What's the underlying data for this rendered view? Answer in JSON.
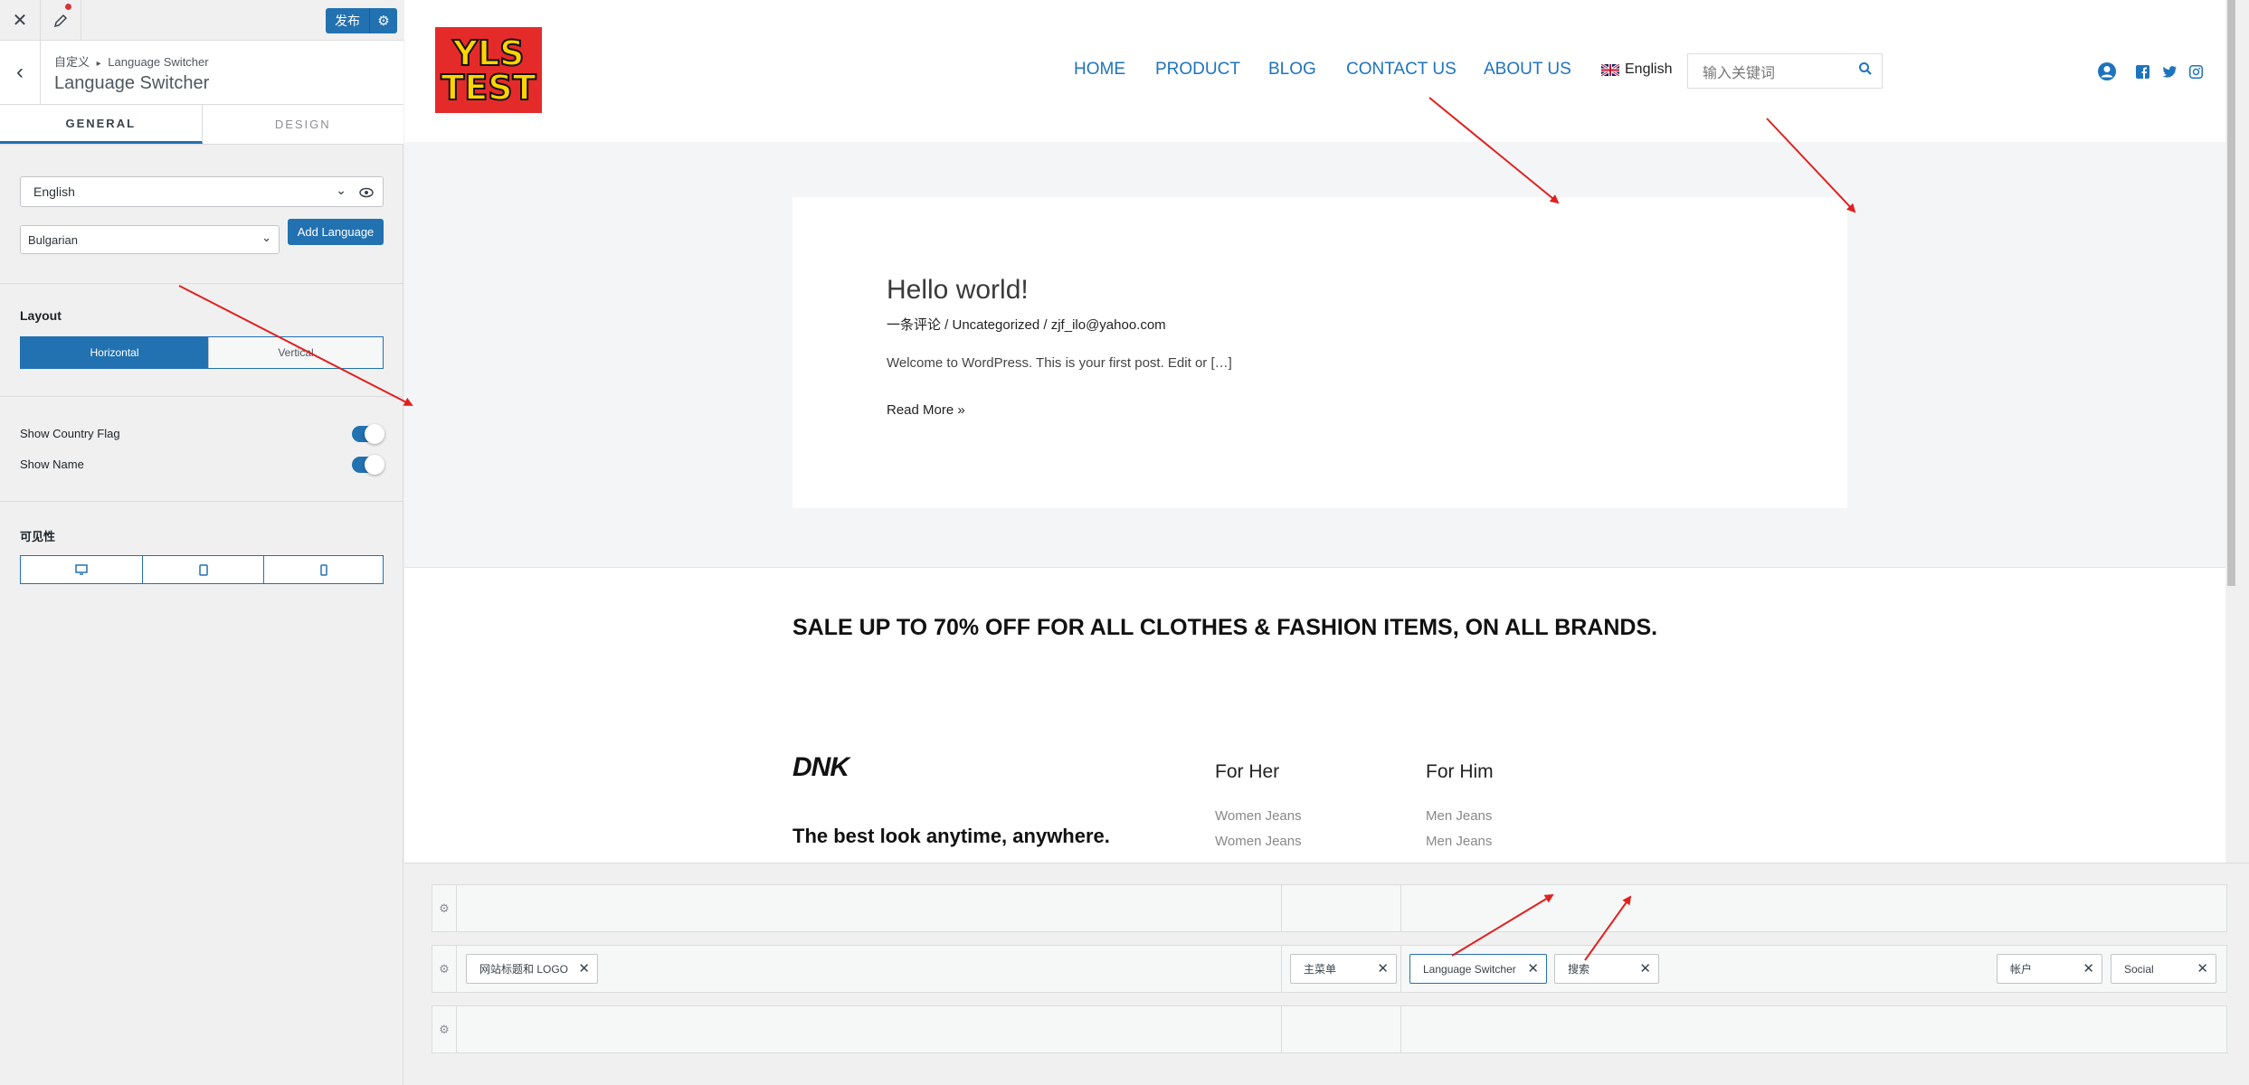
{
  "panel": {
    "close_icon": "close-icon",
    "pen_icon": "pen-icon",
    "publish_label": "发布",
    "breadcrumb_root": "自定义",
    "breadcrumb_sep": "▸",
    "breadcrumb_current": "Language Switcher",
    "section_title": "Language Switcher",
    "tabs": [
      {
        "label": "GENERAL",
        "active": true
      },
      {
        "label": "DESIGN",
        "active": false
      }
    ],
    "current_language": "English",
    "new_language": "Bulgarian",
    "add_language_label": "Add Language",
    "layout_label": "Layout",
    "layout_options": [
      "Horizontal",
      "Vertical"
    ],
    "layout_selected": "Horizontal",
    "show_flag_label": "Show Country Flag",
    "show_flag_on": true,
    "show_name_label": "Show Name",
    "show_name_on": true,
    "visibility_label": "可见性",
    "visibility_devices": [
      "desktop-icon",
      "tablet-icon",
      "mobile-icon"
    ]
  },
  "site": {
    "logo_lines": [
      "YLS",
      "TEST"
    ],
    "nav": [
      "HOME",
      "PRODUCT",
      "BLOG",
      "CONTACT US",
      "ABOUT US"
    ],
    "language": "English",
    "search_placeholder": "输入关键词",
    "post": {
      "title": "Hello world!",
      "meta": "一条评论 / Uncategorized / zjf_ilo@yahoo.com",
      "excerpt": "Welcome to WordPress. This is your first post. Edit or […]",
      "read_more": "Read More »"
    },
    "sale_text": "SALE UP TO 70% OFF FOR ALL CLOTHES & FASHION ITEMS, ON ALL BRANDS.",
    "footer": {
      "brand": "DNK",
      "tagline": "The best look anytime, anywhere.",
      "col1_title": "For Her",
      "col1_links": [
        "Women Jeans",
        "Women Jeans"
      ],
      "col2_title": "For Him",
      "col2_links": [
        "Men Jeans",
        "Men Jeans"
      ]
    }
  },
  "builder": {
    "chips": {
      "logo": "网站标题和 LOGO",
      "menu": "主菜单",
      "lang": "Language Switcher",
      "search": "搜索",
      "account": "帐户",
      "social": "Social"
    }
  },
  "colors": {
    "accent": "#2271b1",
    "link": "#1e73be",
    "annotation": "#e0201e",
    "logo_bg": "#e52a2a",
    "logo_text": "#ffd400"
  }
}
